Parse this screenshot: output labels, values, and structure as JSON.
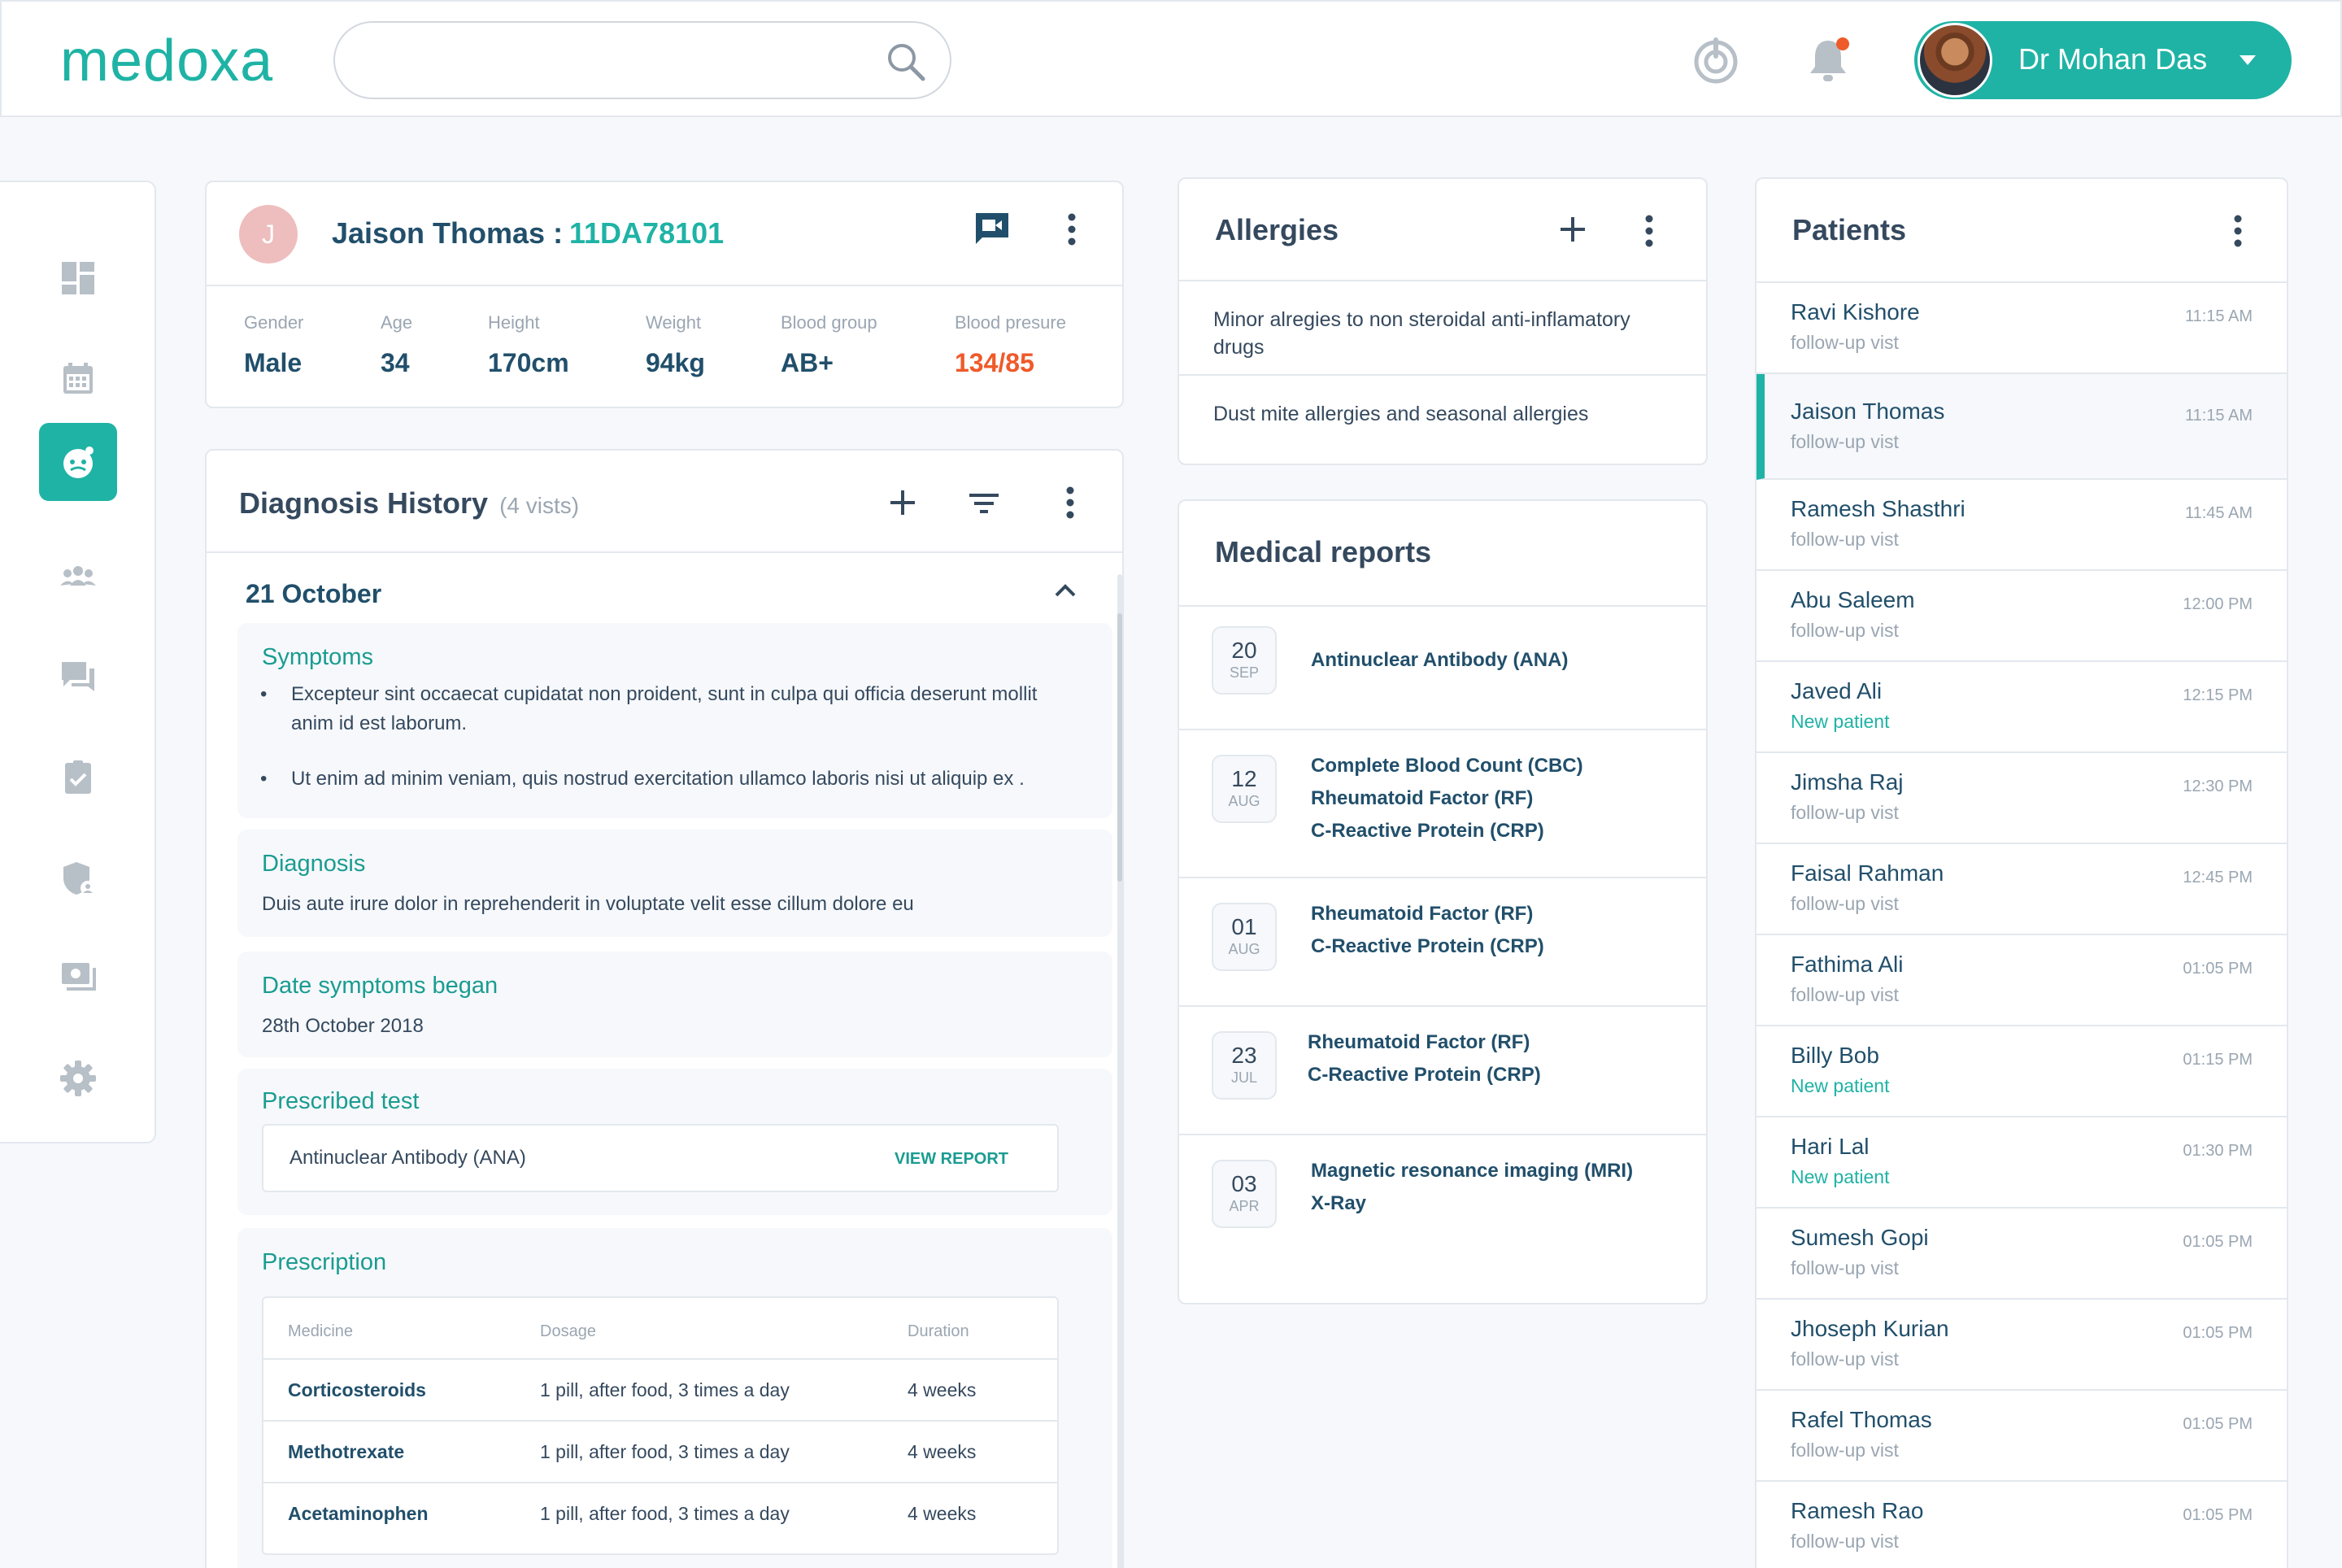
{
  "app": {
    "logo": "medoxa",
    "search_placeholder": ""
  },
  "user": {
    "name": "Dr Mohan Das"
  },
  "patient": {
    "initial": "J",
    "name": "Jaison Thomas :",
    "id": "11DA78101",
    "vitals": [
      {
        "label": "Gender",
        "value": "Male"
      },
      {
        "label": "Age",
        "value": "34"
      },
      {
        "label": "Height",
        "value": "170cm"
      },
      {
        "label": "Weight",
        "value": "94kg"
      },
      {
        "label": "Blood group",
        "value": "AB+"
      },
      {
        "label": "Blood presure",
        "value": "134/85"
      }
    ],
    "alert_color": "#ef5a2a"
  },
  "diagnosis": {
    "title": "Diagnosis History",
    "count": "(4 vists)",
    "date": "21 October",
    "symptoms_title": "Symptoms",
    "symptoms": [
      "Excepteur sint occaecat cupidatat non proident, sunt in culpa qui officia deserunt mollit anim id est laborum.",
      "Ut enim ad minim veniam, quis nostrud exercitation ullamco laboris nisi ut aliquip ex ."
    ],
    "diagnosis_title": "Diagnosis",
    "diagnosis_text": "Duis aute irure dolor in reprehenderit in voluptate velit esse cillum dolore eu",
    "began_title": "Date symptoms began",
    "began_text": "28th October 2018",
    "test_title": "Prescribed test",
    "test_name": "Antinuclear Antibody (ANA)",
    "view_report": "VIEW REPORT",
    "prescription_title": "Prescription",
    "rx_headers": [
      "Medicine",
      "Dosage",
      "Duration"
    ],
    "rx_rows": [
      {
        "medicine": "Corticosteroids",
        "dosage": "1 pill, after food, 3 times a day",
        "duration": "4 weeks"
      },
      {
        "medicine": "Methotrexate",
        "dosage": "1 pill, after food, 3 times a day",
        "duration": "4 weeks"
      },
      {
        "medicine": "Acetaminophen",
        "dosage": "1 pill, after food, 3 times a day",
        "duration": "4 weeks"
      }
    ]
  },
  "allergies": {
    "title": "Allergies",
    "items": [
      "Minor alregies to non steroidal anti-inflamatory drugs",
      "Dust mite allergies and seasonal allergies"
    ]
  },
  "reports": {
    "title": "Medical reports",
    "items": [
      {
        "day": "20",
        "month": "SEP",
        "tests": [
          "Antinuclear Antibody (ANA)"
        ]
      },
      {
        "day": "12",
        "month": "AUG",
        "tests": [
          "Complete Blood Count (CBC)",
          "Rheumatoid Factor (RF)",
          "C-Reactive Protein (CRP)"
        ]
      },
      {
        "day": "01",
        "month": "AUG",
        "tests": [
          "Rheumatoid Factor (RF)",
          "C-Reactive Protein (CRP)"
        ]
      },
      {
        "day": "23",
        "month": "JUL",
        "tests": [
          "Rheumatoid Factor (RF)",
          "C-Reactive Protein (CRP)"
        ]
      },
      {
        "day": "03",
        "month": "APR",
        "tests": [
          "Magnetic resonance imaging (MRI)",
          "X-Ray"
        ]
      }
    ]
  },
  "patients": {
    "title": "Patients",
    "items": [
      {
        "name": "Ravi Kishore",
        "type": "follow-up vist",
        "time": "11:15 AM"
      },
      {
        "name": "Jaison Thomas",
        "type": "follow-up vist",
        "time": "11:15 AM"
      },
      {
        "name": "Ramesh Shasthri",
        "type": "follow-up vist",
        "time": "11:45 AM"
      },
      {
        "name": "Abu Saleem",
        "type": "follow-up vist",
        "time": "12:00 PM"
      },
      {
        "name": "Javed Ali",
        "type": "New patient",
        "time": "12:15 PM"
      },
      {
        "name": "Jimsha Raj",
        "type": "follow-up vist",
        "time": "12:30 PM"
      },
      {
        "name": "Faisal Rahman",
        "type": "follow-up vist",
        "time": "12:45 PM"
      },
      {
        "name": "Fathima Ali",
        "type": "follow-up vist",
        "time": "01:05 PM"
      },
      {
        "name": "Billy Bob",
        "type": "New patient",
        "time": "01:15 PM"
      },
      {
        "name": "Hari Lal",
        "type": "New patient",
        "time": "01:30 PM"
      },
      {
        "name": "Sumesh Gopi",
        "type": "follow-up vist",
        "time": "01:05 PM"
      },
      {
        "name": "Jhoseph Kurian",
        "type": "follow-up vist",
        "time": "01:05 PM"
      },
      {
        "name": "Rafel Thomas",
        "type": "follow-up vist",
        "time": "01:05 PM"
      },
      {
        "name": "Ramesh Rao",
        "type": "follow-up vist",
        "time": "01:05 PM"
      }
    ]
  },
  "icons": {
    "nav": [
      "dashboard-icon",
      "calendar-icon",
      "patient-face-icon",
      "group-icon",
      "chat-icon",
      "document-check-icon",
      "shield-user-icon",
      "monitor-icon",
      "gear-icon"
    ],
    "top": [
      "power-icon",
      "bell-icon"
    ]
  },
  "colors": {
    "accent": "#1fb3a5",
    "title": "#214f6b",
    "notification": "#ef5a2a"
  }
}
